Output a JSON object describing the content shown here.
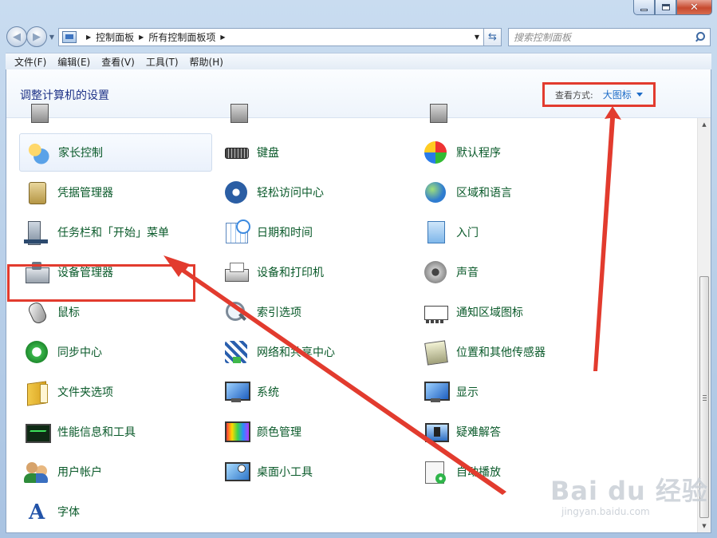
{
  "window": {
    "controls": {
      "minimize": "",
      "maximize": "",
      "close": "✕"
    }
  },
  "navbar": {
    "back_icon": "back-arrow-icon",
    "forward_icon": "forward-arrow-icon",
    "breadcrumbs": [
      "控制面板",
      "所有控制面板项"
    ],
    "search_placeholder": "搜索控制面板"
  },
  "menubar": {
    "items": [
      "文件(F)",
      "编辑(E)",
      "查看(V)",
      "工具(T)",
      "帮助(H)"
    ]
  },
  "header": {
    "title": "调整计算机的设置",
    "view_by_label": "查看方式:",
    "view_by_value": "大图标"
  },
  "items": {
    "col1": [
      "家长控制",
      "凭据管理器",
      "任务栏和「开始」菜单",
      "设备管理器",
      "鼠标",
      "同步中心",
      "文件夹选项",
      "性能信息和工具",
      "用户帐户",
      "字体"
    ],
    "col2": [
      "键盘",
      "轻松访问中心",
      "日期和时间",
      "设备和打印机",
      "索引选项",
      "网络和共享中心",
      "系统",
      "颜色管理",
      "桌面小工具"
    ],
    "col3": [
      "默认程序",
      "区域和语言",
      "入门",
      "声音",
      "通知区域图标",
      "位置和其他传感器",
      "显示",
      "疑难解答",
      "自动播放"
    ]
  },
  "icons": {
    "col1": [
      "parental-controls-icon",
      "credential-manager-icon",
      "taskbar-start-menu-icon",
      "device-manager-icon",
      "mouse-icon",
      "sync-center-icon",
      "folder-options-icon",
      "performance-icon",
      "user-accounts-icon",
      "fonts-icon"
    ],
    "col2": [
      "keyboard-icon",
      "ease-of-access-icon",
      "date-time-icon",
      "devices-printers-icon",
      "indexing-options-icon",
      "network-sharing-icon",
      "system-icon",
      "color-management-icon",
      "desktop-gadgets-icon"
    ],
    "col3": [
      "default-programs-icon",
      "region-language-icon",
      "getting-started-icon",
      "sound-icon",
      "notification-area-icon",
      "location-sensors-icon",
      "display-icon",
      "troubleshooting-icon",
      "autoplay-icon"
    ]
  },
  "watermark": {
    "main": "Bai du 经验",
    "sub": "jingyan.baidu.com"
  },
  "colors": {
    "annotation_red": "#e23b2e",
    "link_green": "#0a5a2a",
    "link_blue": "#1c6bc7"
  }
}
